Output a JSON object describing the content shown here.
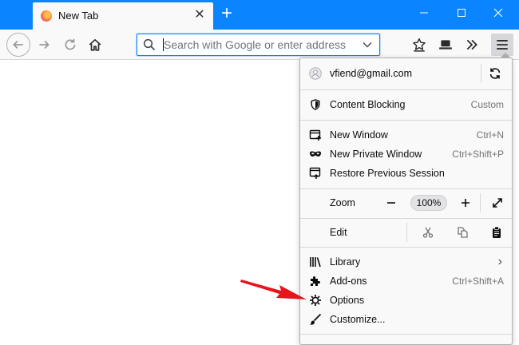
{
  "colors": {
    "accent": "#0a84ff",
    "arrow": "#e8141c"
  },
  "tab": {
    "title": "New Tab",
    "favicon": "firefox-icon",
    "close_glyph": "✕"
  },
  "window_controls": {
    "minimize": "—",
    "maximize": "☐",
    "close": "✕"
  },
  "newtab_glyph": "+",
  "urlbar": {
    "placeholder": "Search with Google or enter address"
  },
  "menu": {
    "account": "vfiend@gmail.com",
    "content_blocking": {
      "label": "Content Blocking",
      "status": "Custom"
    },
    "new_window": {
      "label": "New Window",
      "shortcut": "Ctrl+N"
    },
    "private_window": {
      "label": "New Private Window",
      "shortcut": "Ctrl+Shift+P"
    },
    "restore": {
      "label": "Restore Previous Session"
    },
    "zoom": {
      "label": "Zoom",
      "minus": "—",
      "value": "100%",
      "plus": "+"
    },
    "edit": {
      "label": "Edit"
    },
    "library": {
      "label": "Library",
      "arrow": "›"
    },
    "addons": {
      "label": "Add-ons",
      "shortcut": "Ctrl+Shift+A"
    },
    "options": {
      "label": "Options"
    },
    "customize": {
      "label": "Customize..."
    }
  }
}
